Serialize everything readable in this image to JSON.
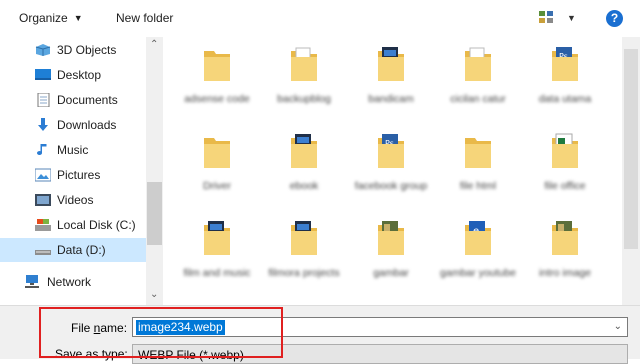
{
  "toolbar": {
    "organize_label": "Organize",
    "new_folder_label": "New folder",
    "help_label": "?"
  },
  "nav": {
    "items": [
      {
        "label": "3D Objects",
        "icon": "3d-objects-icon"
      },
      {
        "label": "Desktop",
        "icon": "desktop-icon"
      },
      {
        "label": "Documents",
        "icon": "documents-icon"
      },
      {
        "label": "Downloads",
        "icon": "downloads-icon"
      },
      {
        "label": "Music",
        "icon": "music-icon"
      },
      {
        "label": "Pictures",
        "icon": "pictures-icon"
      },
      {
        "label": "Videos",
        "icon": "videos-icon"
      },
      {
        "label": "Local Disk (C:)",
        "icon": "local-disk-icon"
      },
      {
        "label": "Data (D:)",
        "icon": "drive-icon",
        "selected": true
      },
      {
        "label": "Network",
        "icon": "network-icon"
      }
    ]
  },
  "files": [
    {
      "name": "adsense code",
      "icon": "folder-icon"
    },
    {
      "name": "backupblog",
      "icon": "folder-docs-icon"
    },
    {
      "name": "bandicam",
      "icon": "folder-dark-icon"
    },
    {
      "name": "cicilan catur",
      "icon": "folder-docs-icon"
    },
    {
      "name": "data utama",
      "icon": "folder-photoshop-icon"
    },
    {
      "name": "Driver",
      "icon": "folder-icon"
    },
    {
      "name": "ebook",
      "icon": "folder-dark-icon"
    },
    {
      "name": "facebook group",
      "icon": "folder-photoshop-icon"
    },
    {
      "name": "file html",
      "icon": "folder-icon"
    },
    {
      "name": "file office",
      "icon": "folder-excel-icon"
    },
    {
      "name": "film and music",
      "icon": "folder-dark-icon"
    },
    {
      "name": "filmora projects",
      "icon": "folder-dark-icon"
    },
    {
      "name": "gambar",
      "icon": "folder-photo-icon"
    },
    {
      "name": "gambar youtube",
      "icon": "folder-blue-icon"
    },
    {
      "name": "intro image",
      "icon": "folder-photo-icon"
    }
  ],
  "form": {
    "file_name_label_pre": "File ",
    "file_name_label_accel": "n",
    "file_name_label_post": "ame:",
    "file_name_value": "image234.webp",
    "save_type_label": "Save as type:",
    "save_type_value": "WEBP File (*.webp)"
  },
  "colors": {
    "accent": "#0078d7",
    "selection": "#cce8ff",
    "highlight_box": "#e02020",
    "folder": "#f6d57a"
  }
}
